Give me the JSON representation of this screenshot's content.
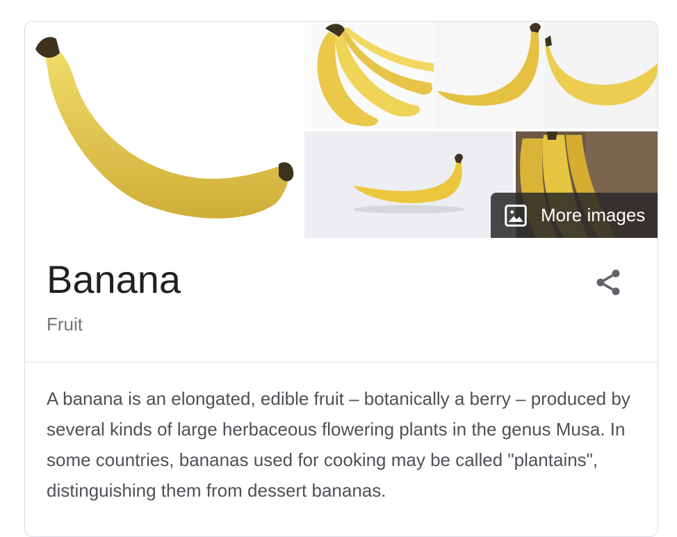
{
  "knowledge_panel": {
    "more_images_label": "More images",
    "title": "Banana",
    "subtitle": "Fruit",
    "description": "A banana is an elongated, edible fruit – botanically a berry – produced by several kinds of large herbaceous flowering plants in the genus Musa. In some countries, bananas used for cooking may be called \"plantains\", distinguishing them from dessert bananas."
  },
  "colors": {
    "banana_yellow": "#e8c84a",
    "banana_shadow": "#c9a52e",
    "stem_dark": "#3d3220",
    "overlay_bg": "#282828",
    "title_text": "#202124",
    "muted_text": "#70757a",
    "divider": "#dadce0"
  },
  "icons": {
    "more_images": "image-icon",
    "share": "share-icon"
  }
}
